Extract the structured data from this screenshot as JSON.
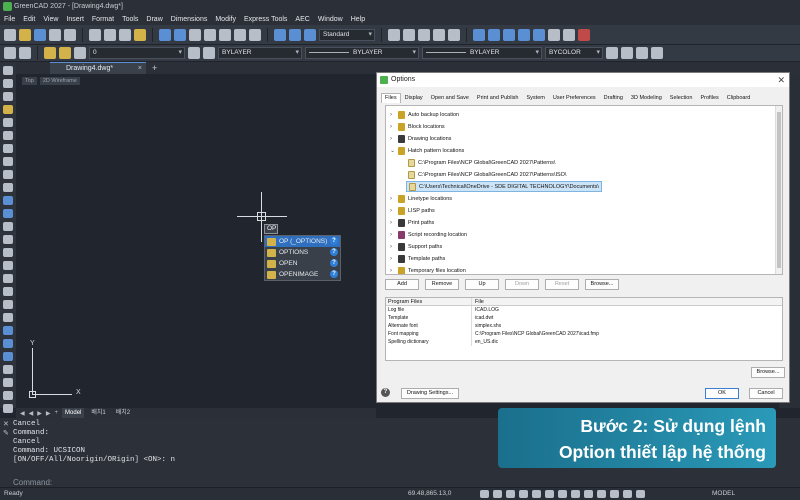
{
  "app": {
    "title": "GreenCAD 2027 - [Drawing4.dwg*]"
  },
  "menu": [
    "File",
    "Edit",
    "View",
    "Insert",
    "Format",
    "Tools",
    "Draw",
    "Dimensions",
    "Modify",
    "Express Tools",
    "AEC",
    "Window",
    "Help"
  ],
  "toolbar": {
    "textstyle": "Standard",
    "layer": "0",
    "color": "BYLAYER",
    "linetype": "BYLAYER",
    "lineweight": "BYLAYER",
    "plotstyle": "BYCOLOR"
  },
  "doc_tab": {
    "name": "Drawing4.dwg*",
    "close": "×",
    "plus": "+"
  },
  "viewport": {
    "view": "Top",
    "style": "2D Wireframe"
  },
  "autocomplete": {
    "typed": "OP",
    "items": [
      {
        "label": "OP (_OPTIONS)"
      },
      {
        "label": "OPTIONS"
      },
      {
        "label": "OPEN"
      },
      {
        "label": "OPENIMAGE"
      }
    ],
    "help_glyph": "?"
  },
  "ucs": {
    "x": "X",
    "y": "Y"
  },
  "layout_tabs": [
    "Model",
    "배치1",
    "배치2"
  ],
  "command": {
    "history": [
      "Cancel",
      "Command:",
      "Cancel",
      "Command: UCSICON",
      "[ON/OFF/All/Noorigin/ORigin] <ON>: n"
    ],
    "prompt": "Command:"
  },
  "status": {
    "ready": "Ready",
    "coords": "69.48,865.13,0",
    "model": "MODEL"
  },
  "banner": {
    "line1": "Bước 2: Sử dụng lệnh",
    "line2": "Option thiết lập hệ thống"
  },
  "dialog": {
    "title": "Options",
    "tabs": [
      "Files",
      "Display",
      "Open and Save",
      "Print and Publish",
      "System",
      "User Preferences",
      "Drafting",
      "3D Modeling",
      "Selection",
      "Profiles",
      "Clipboard"
    ],
    "tree": [
      {
        "label": "Auto backup location",
        "level": 0
      },
      {
        "label": "Block locations",
        "level": 0
      },
      {
        "label": "Drawing locations",
        "level": 0
      },
      {
        "label": "Hatch pattern locations",
        "level": 0,
        "expanded": true
      },
      {
        "label": "C:\\Program Files\\NCP Global\\GreenCAD 2027\\Patterns\\",
        "level": 1
      },
      {
        "label": "C:\\Program Files\\NCP Global\\GreenCAD 2027\\Patterns\\ISO\\",
        "level": 1
      },
      {
        "label": "C:\\Users\\Technical\\OneDrive - SDE DIGITAL TECHNOLOGY\\Documents\\",
        "level": 1,
        "selected": true
      },
      {
        "label": "Linetype locations",
        "level": 0
      },
      {
        "label": "LISP paths",
        "level": 0
      },
      {
        "label": "Print paths",
        "level": 0
      },
      {
        "label": "Script recording location",
        "level": 0
      },
      {
        "label": "Support paths",
        "level": 0
      },
      {
        "label": "Template paths",
        "level": 0
      },
      {
        "label": "Temporary files location",
        "level": 0
      }
    ],
    "buttons": {
      "add": "Add",
      "remove": "Remove",
      "up": "Up",
      "down": "Down",
      "reset": "Reset",
      "browse": "Browse...",
      "browse2": "Browse...",
      "drawing_settings": "Drawing Settings...",
      "ok": "OK",
      "cancel": "Cancel"
    },
    "props_header": [
      "Program Files",
      "File"
    ],
    "props_rows": [
      [
        "Log file",
        "ICAD.LOG"
      ],
      [
        "Template",
        "icad.dwt"
      ],
      [
        "Alternate font",
        "simplex.shx"
      ],
      [
        "Font mapping",
        "C:\\Program Files\\NCP Global\\GreenCAD 2027\\icad.fmp"
      ],
      [
        "Spelling dictionary",
        "en_US.dic"
      ]
    ],
    "help_glyph": "?",
    "close_glyph": "✕"
  }
}
